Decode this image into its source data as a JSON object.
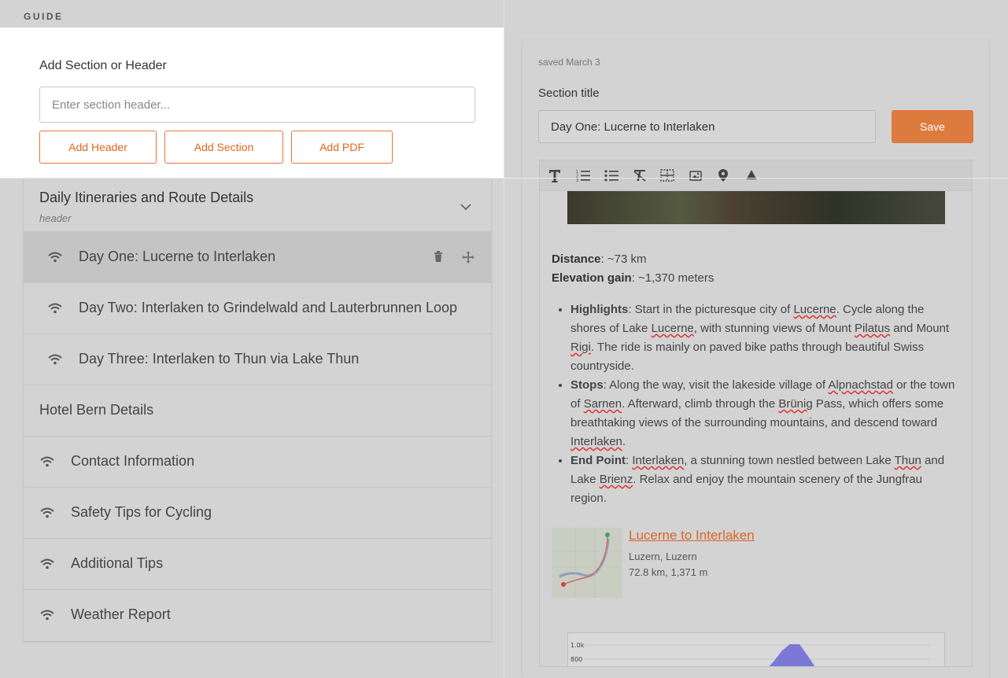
{
  "guide_label": "GUIDE",
  "add_card": {
    "title": "Add Section or Header",
    "placeholder": "Enter section header...",
    "buttons": {
      "header": "Add Header",
      "section": "Add Section",
      "pdf": "Add PDF"
    }
  },
  "sections": {
    "header_title": "Daily Itineraries and Route Details",
    "header_sub": "header",
    "day_items": [
      "Day One: Lucerne to Interlaken",
      "Day Two: Interlaken to Grindelwald and Lauterbrunnen Loop",
      "Day Three: Interlaken to Thun via Lake Thun"
    ],
    "plain_header": "Hotel Bern Details",
    "items": [
      "Contact Information",
      "Safety Tips for Cycling",
      "Additional Tips",
      "Weather Report"
    ]
  },
  "editor": {
    "saved": "saved March 3",
    "section_title_label": "Section title",
    "section_title_value": "Day One: Lucerne to Interlaken",
    "save_label": "Save",
    "distance_label": "Distance",
    "distance_value": ": ~73 km",
    "elevation_label": "Elevation gain",
    "elevation_value": ": ~1,370 meters",
    "route": {
      "title": "Lucerne to Interlaken",
      "location": "Luzern, Luzern",
      "stats": "72.8 km, 1,371 m"
    },
    "elev_ticks": [
      "1.0k",
      "800"
    ]
  },
  "colors": {
    "accent": "#e0661f",
    "save_bg": "#dd7a3e",
    "elev_fill": "#7b78d8"
  }
}
